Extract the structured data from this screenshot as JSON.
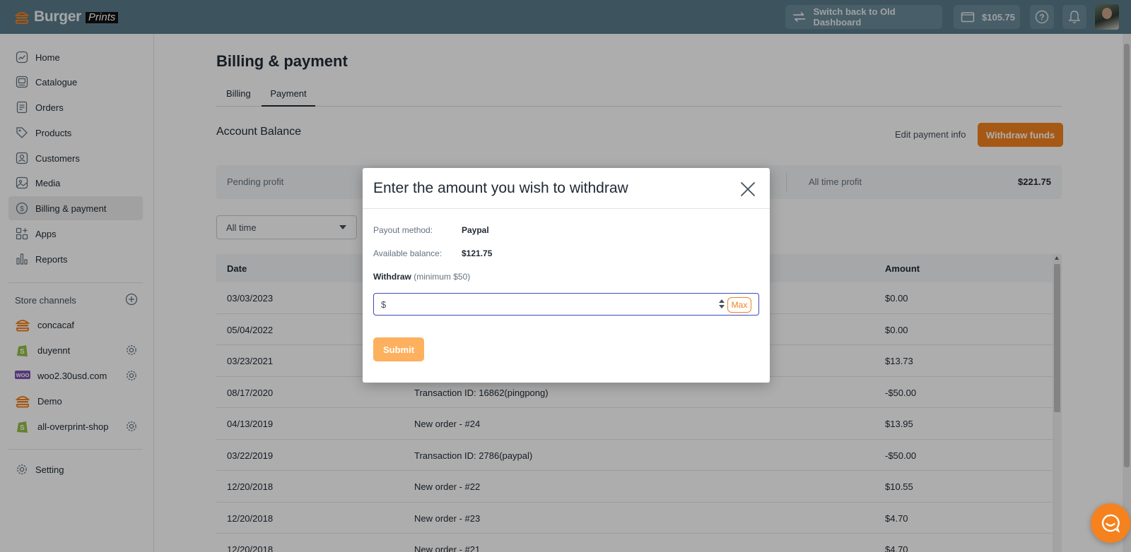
{
  "brand": {
    "name": "Burger",
    "sub": "Prints",
    "color": "#f5821f"
  },
  "topbar": {
    "switch_label": "Switch back to Old Dashboard",
    "balance": "$105.75"
  },
  "sidebar": {
    "items": [
      {
        "label": "Home",
        "icon": "chart-line-icon"
      },
      {
        "label": "Catalogue",
        "icon": "catalogue-icon"
      },
      {
        "label": "Orders",
        "icon": "orders-icon"
      },
      {
        "label": "Products",
        "icon": "tag-icon"
      },
      {
        "label": "Customers",
        "icon": "customers-icon"
      },
      {
        "label": "Media",
        "icon": "image-icon"
      },
      {
        "label": "Billing & payment",
        "icon": "dollar-icon",
        "active": true
      },
      {
        "label": "Apps",
        "icon": "apps-icon"
      },
      {
        "label": "Reports",
        "icon": "bar-chart-icon"
      }
    ],
    "channels_title": "Store channels",
    "stores": [
      {
        "label": "concacaf",
        "platform": "burger-icon",
        "gear": false
      },
      {
        "label": "duyennt",
        "platform": "shopify-icon",
        "gear": true
      },
      {
        "label": "woo2.30usd.com",
        "platform": "woo-icon",
        "gear": true
      },
      {
        "label": "Demo",
        "platform": "burger-icon",
        "gear": false
      },
      {
        "label": "all-overprint-shop",
        "platform": "shopify-icon",
        "gear": true
      }
    ],
    "setting_label": "Setting"
  },
  "main": {
    "title": "Billing & payment",
    "tabs": [
      {
        "label": "Billing"
      },
      {
        "label": "Payment",
        "active": true
      }
    ],
    "section_title": "Account Balance",
    "edit_link": "Edit payment info",
    "withdraw_button": "Withdraw funds",
    "stats": {
      "pending_label": "Pending profit",
      "all_time_label": "All time profit",
      "all_time_value": "$221.75"
    },
    "filter_value": "All time",
    "table": {
      "headers": {
        "date": "Date",
        "amount": "Amount"
      },
      "rows": [
        {
          "date": "03/03/2023",
          "desc": "",
          "amount": "$0.00"
        },
        {
          "date": "05/04/2022",
          "desc": "",
          "amount": "$0.00"
        },
        {
          "date": "03/23/2021",
          "desc": "",
          "amount": "$13.73"
        },
        {
          "date": "08/17/2020",
          "desc": "Transaction ID: 16862(pingpong)",
          "amount": "-$50.00"
        },
        {
          "date": "04/13/2019",
          "desc": "New order - #24",
          "amount": "$13.95"
        },
        {
          "date": "03/22/2019",
          "desc": "Transaction ID: 2786(paypal)",
          "amount": "-$50.00"
        },
        {
          "date": "12/20/2018",
          "desc": "New order - #22",
          "amount": "$10.55"
        },
        {
          "date": "12/20/2018",
          "desc": "New order - #23",
          "amount": "$4.70"
        },
        {
          "date": "12/20/2018",
          "desc": "New order - #21",
          "amount": "$4.70"
        }
      ]
    }
  },
  "modal": {
    "title": "Enter the amount you wish to withdraw",
    "payout_label": "Payout method:",
    "payout_value": "Paypal",
    "available_label": "Available balance:",
    "available_value": "$121.75",
    "withdraw_label": "Withdraw",
    "withdraw_hint": "(minimum $50)",
    "currency_prefix": "$",
    "amount_value": "",
    "max_label": "Max",
    "submit_label": "Submit"
  }
}
